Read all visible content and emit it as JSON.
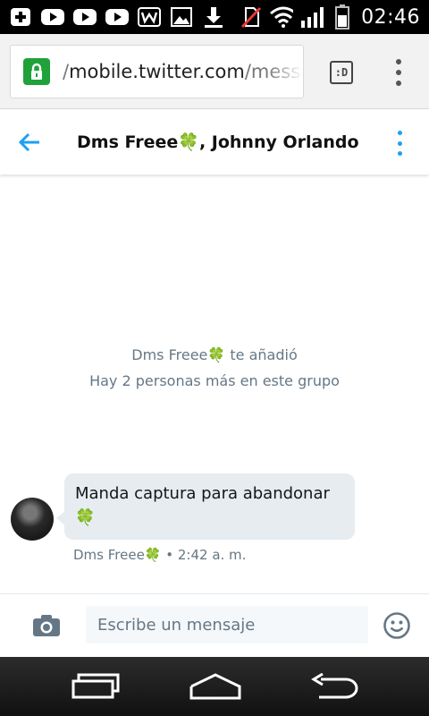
{
  "status_bar": {
    "time": "02:46",
    "icons": [
      "add-icon",
      "youtube-icon",
      "youtube-icon",
      "youtube-icon",
      "w-icon",
      "image-icon",
      "download-icon",
      "no-sim-icon",
      "wifi-icon",
      "signal-icon",
      "battery-icon"
    ]
  },
  "browser": {
    "url_prefix": "/",
    "url_domain": "mobile.twitter.com",
    "url_path": "/messa",
    "tab_button_label": ":D"
  },
  "header": {
    "title": "Dms Freee🍀, Johnny Orlando"
  },
  "conversation": {
    "system_line_1": "Dms Freee🍀 te añadió",
    "system_line_2": "Hay 2 personas más en este grupo",
    "message_text_1": "Manda captura para abandonar",
    "message_text_2": "🍀",
    "message_meta": "Dms Freee🍀 • 2:42 a. m."
  },
  "composer": {
    "placeholder": "Escribe un mensaje"
  },
  "colors": {
    "accent": "#1da1f2",
    "secure": "#1fa23a",
    "bubble": "#e6ecf0",
    "muted": "#657786"
  }
}
